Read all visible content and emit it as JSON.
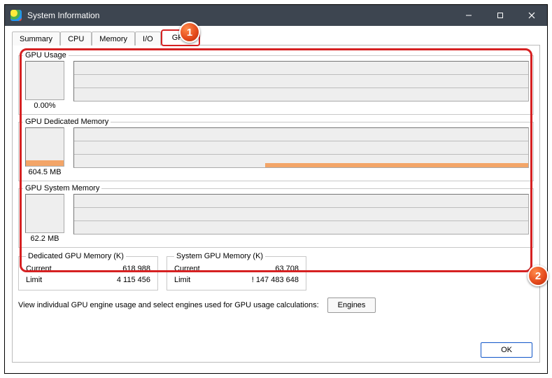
{
  "window": {
    "title": "System Information"
  },
  "tabs": {
    "summary": "Summary",
    "cpu": "CPU",
    "memory": "Memory",
    "io": "I/O",
    "gpu": "GPU"
  },
  "metrics": {
    "usage": {
      "legend": "GPU Usage",
      "value_label": "0.00%"
    },
    "dedicated": {
      "legend": "GPU Dedicated Memory",
      "value_label": "604.5 MB"
    },
    "system": {
      "legend": "GPU System Memory",
      "value_label": "62.2 MB"
    }
  },
  "stats": {
    "dedicated": {
      "legend": "Dedicated GPU Memory (K)",
      "current_label": "Current",
      "current_value": "618 988",
      "limit_label": "Limit",
      "limit_value": "4 115 456"
    },
    "system": {
      "legend": "System GPU Memory (K)",
      "current_label": "Current",
      "current_value": "63 708",
      "limit_label": "Limit",
      "limit_value": "! 147 483 648"
    }
  },
  "engines": {
    "text": "View individual GPU engine usage and select engines used for GPU usage calculations:",
    "button": "Engines"
  },
  "ok_button": "OK",
  "callouts": {
    "one": "1",
    "two": "2"
  }
}
